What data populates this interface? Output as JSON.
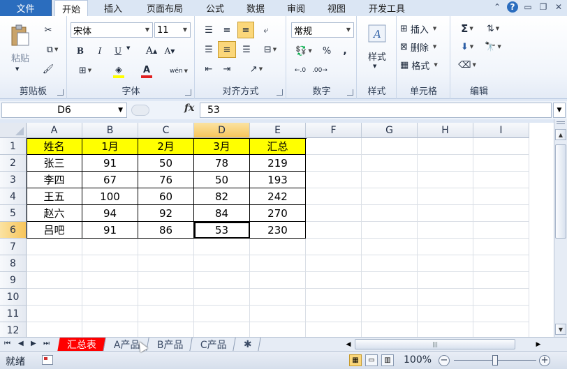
{
  "ribbon": {
    "file_tab": "文件",
    "tabs": [
      "开始",
      "插入",
      "页面布局",
      "公式",
      "数据",
      "审阅",
      "视图",
      "开发工具"
    ],
    "active_tab": "开始",
    "groups": {
      "clipboard": {
        "label": "剪贴板",
        "paste": "粘贴"
      },
      "font": {
        "label": "字体",
        "font_name": "宋体",
        "font_size": "11",
        "bold": "B",
        "italic": "I",
        "underline": "U",
        "grow": "A",
        "shrink": "A",
        "phonetic": "wén"
      },
      "alignment": {
        "label": "对齐方式"
      },
      "number": {
        "label": "数字",
        "format": "常规",
        "percent": "%",
        "comma": ","
      },
      "styles": {
        "label": "样式",
        "button": "样式"
      },
      "cells": {
        "label": "单元格",
        "insert": "插入",
        "delete": "删除",
        "format": "格式"
      },
      "editing": {
        "label": "编辑"
      }
    }
  },
  "formula_bar": {
    "name_box": "D6",
    "fx": "fx",
    "value": "53"
  },
  "grid": {
    "columns": [
      "A",
      "B",
      "C",
      "D",
      "E",
      "F",
      "G",
      "H",
      "I"
    ],
    "selected_column": "D",
    "rows": [
      "1",
      "2",
      "3",
      "4",
      "5",
      "6",
      "7",
      "8",
      "9",
      "10",
      "11",
      "12"
    ],
    "selected_row": "6",
    "data": [
      [
        "姓名",
        "1月",
        "2月",
        "3月",
        "汇总"
      ],
      [
        "张三",
        "91",
        "50",
        "78",
        "219"
      ],
      [
        "李四",
        "67",
        "76",
        "50",
        "193"
      ],
      [
        "王五",
        "100",
        "60",
        "82",
        "242"
      ],
      [
        "赵六",
        "94",
        "92",
        "84",
        "270"
      ],
      [
        "吕吧",
        "91",
        "86",
        "53",
        "230"
      ]
    ],
    "header_fill": "#ffff00",
    "active_cell": "D6"
  },
  "sheets": {
    "tabs": [
      "汇总表",
      "A产品",
      "B产品",
      "C产品"
    ],
    "active": "汇总表",
    "active_color": "#ff0000"
  },
  "status": {
    "ready": "就绪",
    "zoom": "100%"
  }
}
